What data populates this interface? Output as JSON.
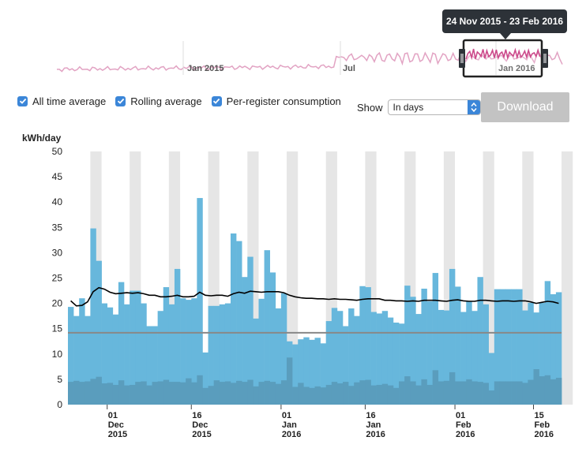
{
  "navigator": {
    "range_label": "24 Nov 2015 - 23 Feb 2016",
    "labels": [
      "Jan 2015",
      "Jul",
      "Jan 2016"
    ],
    "line_color": "#e2a3c3",
    "selected_color": "#cc4a8b"
  },
  "controls": {
    "checkboxes": [
      {
        "label": "All time average",
        "checked": true
      },
      {
        "label": "Rolling average",
        "checked": true
      },
      {
        "label": "Per-register consumption",
        "checked": true
      }
    ],
    "show_label": "Show",
    "show_value": "In days",
    "download_label": "Download"
  },
  "colors": {
    "bar": "#67b7dc",
    "bar_dark": "#5a9dbd",
    "weekend": "#e6e6e6",
    "rolling": "#000000",
    "average": "#888888",
    "accent": "#3b86d8"
  },
  "chart_data": {
    "type": "bar",
    "ylabel": "kWh/day",
    "ylim": [
      0,
      50
    ],
    "yticks": [
      0,
      5,
      10,
      15,
      20,
      25,
      30,
      35,
      40,
      45,
      50
    ],
    "start_date": "2015-11-24",
    "x_tick_labels": [
      {
        "date": "2015-12-01",
        "lines": [
          "01",
          "Dec",
          "2015"
        ]
      },
      {
        "date": "2015-12-16",
        "lines": [
          "16",
          "Dec",
          "2015"
        ]
      },
      {
        "date": "2016-01-01",
        "lines": [
          "01",
          "Jan",
          "2016"
        ]
      },
      {
        "date": "2016-01-16",
        "lines": [
          "16",
          "Jan",
          "2016"
        ]
      },
      {
        "date": "2016-02-01",
        "lines": [
          "01",
          "Feb",
          "2016"
        ]
      },
      {
        "date": "2016-02-15",
        "lines": [
          "15",
          "Feb",
          "2016"
        ]
      }
    ],
    "weekend_dates": [
      "2015-11-28",
      "2015-12-05",
      "2015-12-12",
      "2015-12-19",
      "2015-12-26",
      "2016-01-02",
      "2016-01-09",
      "2016-01-16",
      "2016-01-23",
      "2016-01-30",
      "2016-02-06",
      "2016-02-13",
      "2016-02-20"
    ],
    "all_time_average": 14.2,
    "series": [
      {
        "name": "Consumption",
        "values": [
          19.3,
          17.5,
          21.0,
          17.5,
          34.8,
          28.4,
          20.0,
          19.2,
          17.8,
          24.2,
          19.8,
          22.5,
          22.5,
          20.0,
          15.5,
          15.5,
          18.5,
          23.2,
          19.8,
          26.8,
          21.0,
          20.7,
          21.0,
          40.8,
          10.3,
          19.5,
          19.5,
          19.8,
          20.0,
          33.8,
          32.3,
          25.2,
          29.2,
          17.0,
          20.9,
          30.5,
          26.1,
          19.0,
          22.0,
          12.5,
          11.9,
          12.9,
          13.3,
          12.8,
          13.2,
          12.1,
          16.5,
          19.1,
          18.5,
          15.5,
          19.0,
          17.5,
          23.4,
          23.2,
          18.3,
          18.0,
          18.5,
          17.2,
          16.2,
          16.0,
          23.5,
          21.3,
          17.9,
          22.9,
          20.4,
          26.0,
          18.7,
          18.6,
          26.8,
          23.3,
          18.3,
          20.4,
          18.5,
          25.2,
          19.8,
          10.2,
          22.8,
          22.8,
          22.8,
          22.8,
          22.8,
          18.6,
          20.1,
          18.2,
          20.1,
          24.4,
          21.8,
          22.2
        ]
      },
      {
        "name": "Per-register",
        "values": [
          4.5,
          4.7,
          4.5,
          4.6,
          5.1,
          5.5,
          4.2,
          4.3,
          3.9,
          4.8,
          3.8,
          3.9,
          4.5,
          4.6,
          3.8,
          4.5,
          4.6,
          4.9,
          4.5,
          4.5,
          4.4,
          5.2,
          4.4,
          5.8,
          3.3,
          3.7,
          4.8,
          4.5,
          4.6,
          4.3,
          4.7,
          4.5,
          4.9,
          3.6,
          4.5,
          4.7,
          4.5,
          4.1,
          4.8,
          9.3,
          3.5,
          4.3,
          3.5,
          3.3,
          3.6,
          3.4,
          3.9,
          4.5,
          4.2,
          4.5,
          3.7,
          4.4,
          4.8,
          4.9,
          3.8,
          3.9,
          4.1,
          3.8,
          3.3,
          4.6,
          5.6,
          4.6,
          3.8,
          5.0,
          3.9,
          6.8,
          4.6,
          4.7,
          6.4,
          4.6,
          4.6,
          5.0,
          4.6,
          4.5,
          4.3,
          2.8,
          4.6,
          4.6,
          4.6,
          4.6,
          4.6,
          4.3,
          4.9,
          7.0,
          5.6,
          5.8,
          5.0,
          5.3
        ]
      },
      {
        "name": "Rolling average",
        "values": [
          20.5,
          19.5,
          19.6,
          20.3,
          22.3,
          23.1,
          22.8,
          22.2,
          21.9,
          22.0,
          22.1,
          22.0,
          22.1,
          21.9,
          21.6,
          21.6,
          21.3,
          21.3,
          21.4,
          21.6,
          21.3,
          21.3,
          21.4,
          22.2,
          21.6,
          21.5,
          21.6,
          21.6,
          21.4,
          21.9,
          22.2,
          22.0,
          22.4,
          22.3,
          22.2,
          22.3,
          22.3,
          22.3,
          22.1,
          21.6,
          21.3,
          21.1,
          21.0,
          21.0,
          20.9,
          20.9,
          20.8,
          20.9,
          20.8,
          20.8,
          20.7,
          20.6,
          20.8,
          20.9,
          20.9,
          20.9,
          20.6,
          20.6,
          20.5,
          20.5,
          20.4,
          20.5,
          20.4,
          20.6,
          20.6,
          20.6,
          20.5,
          20.4,
          20.6,
          20.7,
          20.5,
          20.4,
          20.4,
          20.6,
          20.6,
          20.5,
          20.4,
          20.5,
          20.5,
          20.4,
          20.5,
          20.5,
          20.3,
          20.0,
          20.2,
          20.4,
          20.3,
          20.0
        ]
      }
    ]
  }
}
